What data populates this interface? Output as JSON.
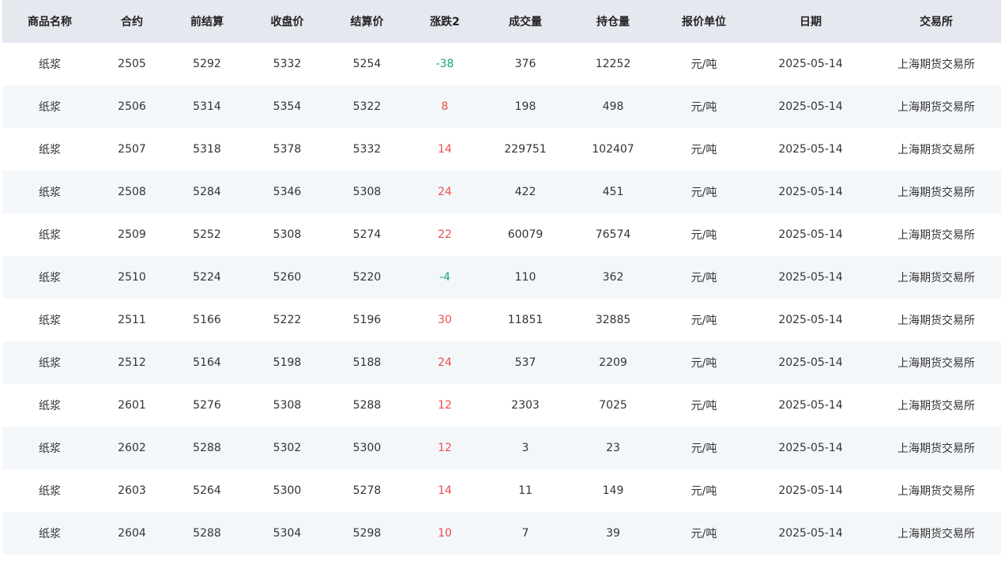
{
  "table": {
    "headers": [
      "商品名称",
      "合约",
      "前结算",
      "收盘价",
      "结算价",
      "涨跌2",
      "成交量",
      "持仓量",
      "报价单位",
      "日期",
      "交易所"
    ],
    "colors": {
      "up": "#e84f4f",
      "down": "#1aa37a",
      "header_bg": "#e6e8f0",
      "stripe_bg": "#f4f7fa"
    },
    "rows": [
      [
        "纸浆",
        "2505",
        "5292",
        "5332",
        "5254",
        "-38",
        "376",
        "12252",
        "元/吨",
        "2025-05-14",
        "上海期货交易所"
      ],
      [
        "纸浆",
        "2506",
        "5314",
        "5354",
        "5322",
        "8",
        "198",
        "498",
        "元/吨",
        "2025-05-14",
        "上海期货交易所"
      ],
      [
        "纸浆",
        "2507",
        "5318",
        "5378",
        "5332",
        "14",
        "229751",
        "102407",
        "元/吨",
        "2025-05-14",
        "上海期货交易所"
      ],
      [
        "纸浆",
        "2508",
        "5284",
        "5346",
        "5308",
        "24",
        "422",
        "451",
        "元/吨",
        "2025-05-14",
        "上海期货交易所"
      ],
      [
        "纸浆",
        "2509",
        "5252",
        "5308",
        "5274",
        "22",
        "60079",
        "76574",
        "元/吨",
        "2025-05-14",
        "上海期货交易所"
      ],
      [
        "纸浆",
        "2510",
        "5224",
        "5260",
        "5220",
        "-4",
        "110",
        "362",
        "元/吨",
        "2025-05-14",
        "上海期货交易所"
      ],
      [
        "纸浆",
        "2511",
        "5166",
        "5222",
        "5196",
        "30",
        "11851",
        "32885",
        "元/吨",
        "2025-05-14",
        "上海期货交易所"
      ],
      [
        "纸浆",
        "2512",
        "5164",
        "5198",
        "5188",
        "24",
        "537",
        "2209",
        "元/吨",
        "2025-05-14",
        "上海期货交易所"
      ],
      [
        "纸浆",
        "2601",
        "5276",
        "5308",
        "5288",
        "12",
        "2303",
        "7025",
        "元/吨",
        "2025-05-14",
        "上海期货交易所"
      ],
      [
        "纸浆",
        "2602",
        "5288",
        "5302",
        "5300",
        "12",
        "3",
        "23",
        "元/吨",
        "2025-05-14",
        "上海期货交易所"
      ],
      [
        "纸浆",
        "2603",
        "5264",
        "5300",
        "5278",
        "14",
        "11",
        "149",
        "元/吨",
        "2025-05-14",
        "上海期货交易所"
      ],
      [
        "纸浆",
        "2604",
        "5288",
        "5304",
        "5298",
        "10",
        "7",
        "39",
        "元/吨",
        "2025-05-14",
        "上海期货交易所"
      ]
    ]
  }
}
